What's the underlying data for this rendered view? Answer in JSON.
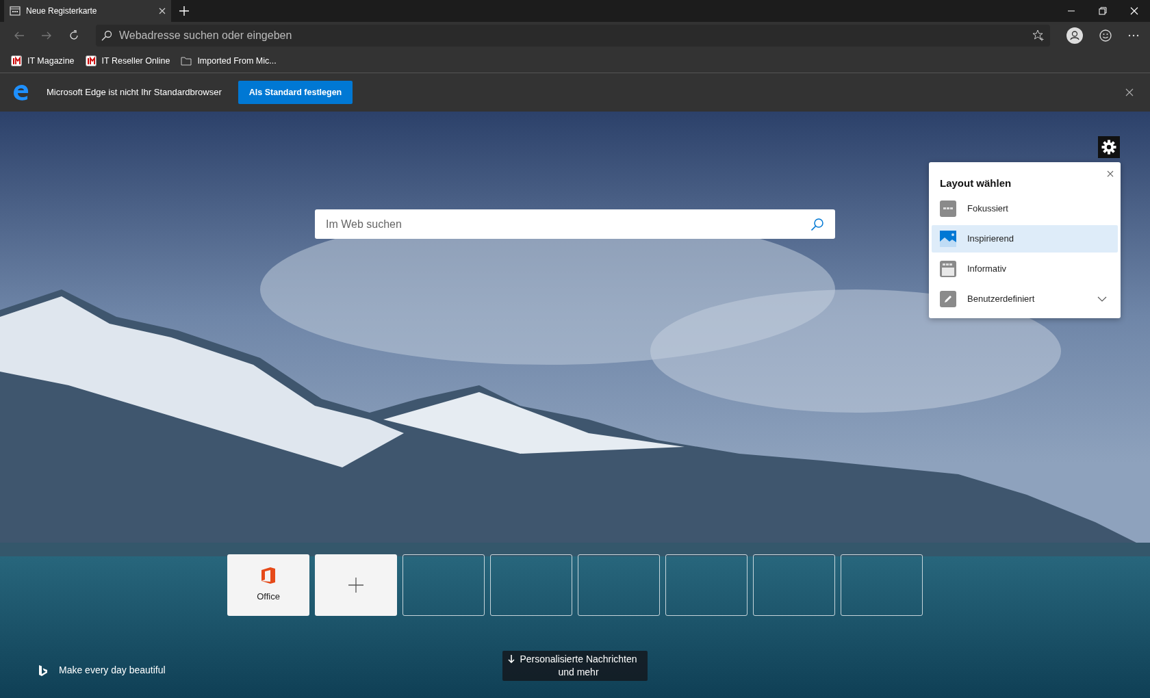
{
  "tab": {
    "title": "Neue Registerkarte",
    "selected": true
  },
  "address_bar": {
    "placeholder": "Webadresse suchen oder eingeben"
  },
  "favorites": [
    {
      "label": "IT Magazine",
      "kind": "site"
    },
    {
      "label": "IT Reseller Online",
      "kind": "site"
    },
    {
      "label": "Imported From Mic...",
      "kind": "folder"
    }
  ],
  "infobar": {
    "message": "Microsoft Edge ist nicht Ihr Standardbrowser",
    "button": "Als Standard festlegen"
  },
  "search": {
    "placeholder": "Im Web suchen"
  },
  "layout_panel": {
    "title": "Layout wählen",
    "options": [
      {
        "label": "Fokussiert",
        "kind": "focused",
        "selected": false
      },
      {
        "label": "Inspirierend",
        "kind": "inspirational",
        "selected": true
      },
      {
        "label": "Informativ",
        "kind": "informational",
        "selected": false
      },
      {
        "label": "Benutzerdefiniert",
        "kind": "custom",
        "selected": false
      }
    ]
  },
  "quick_links": [
    {
      "kind": "site",
      "label": "Office"
    },
    {
      "kind": "add"
    },
    {
      "kind": "empty"
    },
    {
      "kind": "empty"
    },
    {
      "kind": "empty"
    },
    {
      "kind": "empty"
    },
    {
      "kind": "empty"
    },
    {
      "kind": "empty"
    }
  ],
  "footer": {
    "caption": "Make every day beautiful",
    "news_button": "Personalisierte Nachrichten und mehr"
  }
}
